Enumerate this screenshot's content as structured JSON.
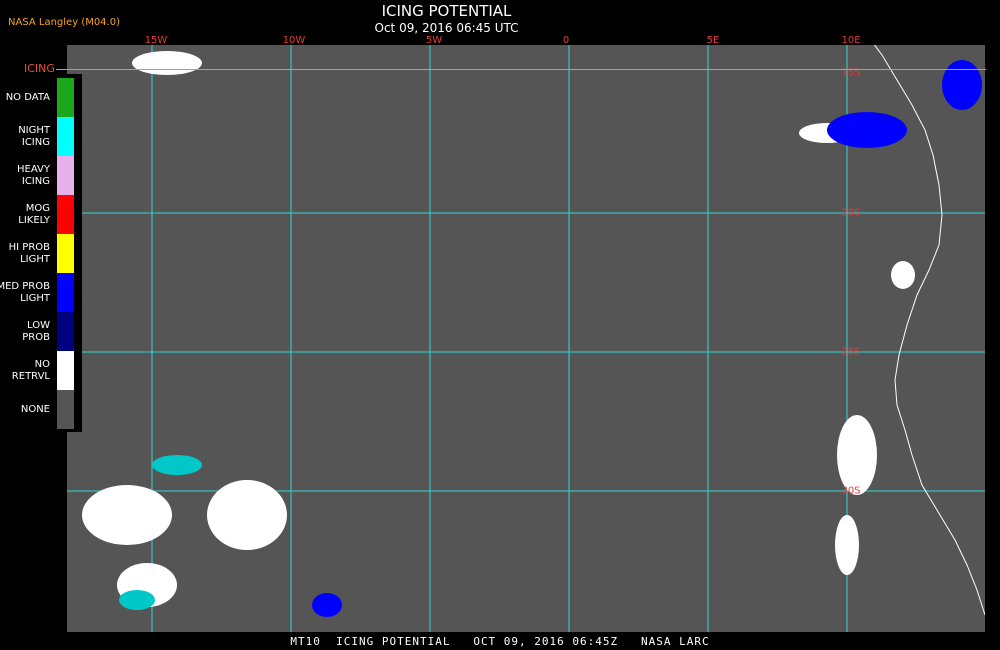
{
  "header": {
    "producer": "NASA Langley (M04.0)",
    "title": "ICING POTENTIAL",
    "timestamp": "Oct 09, 2016 06:45 UTC"
  },
  "legend": {
    "title": "ICING",
    "items": [
      {
        "label": "NO DATA",
        "color": "#1aa81a"
      },
      {
        "label": "NIGHT\nICING",
        "color": "#00ffff"
      },
      {
        "label": "HEAVY\nICING",
        "color": "#e8b0e8"
      },
      {
        "label": "MOG\nLIKELY",
        "color": "#ff0000"
      },
      {
        "label": "HI PROB\nLIGHT",
        "color": "#ffff00"
      },
      {
        "label": "MED PROB\nLIGHT",
        "color": "#0000ff"
      },
      {
        "label": "LOW\nPROB",
        "color": "#000080"
      },
      {
        "label": "NO\nRETRVL",
        "color": "#ffffff"
      },
      {
        "label": "NONE",
        "color": "#555555"
      }
    ]
  },
  "grid": {
    "lon_labels": [
      "15W",
      "10W",
      "5W",
      "0",
      "5E",
      "10E"
    ],
    "lat_labels": [
      "15S",
      "20S",
      "25S",
      "30S"
    ]
  },
  "footer": "MT10  ICING POTENTIAL   OCT 09, 2016 06:45Z   NASA LARC",
  "colors": {
    "background": "#555555",
    "grid": "#2fd6d6",
    "labels": "#e23b3b",
    "coastline": "#ffffff"
  }
}
